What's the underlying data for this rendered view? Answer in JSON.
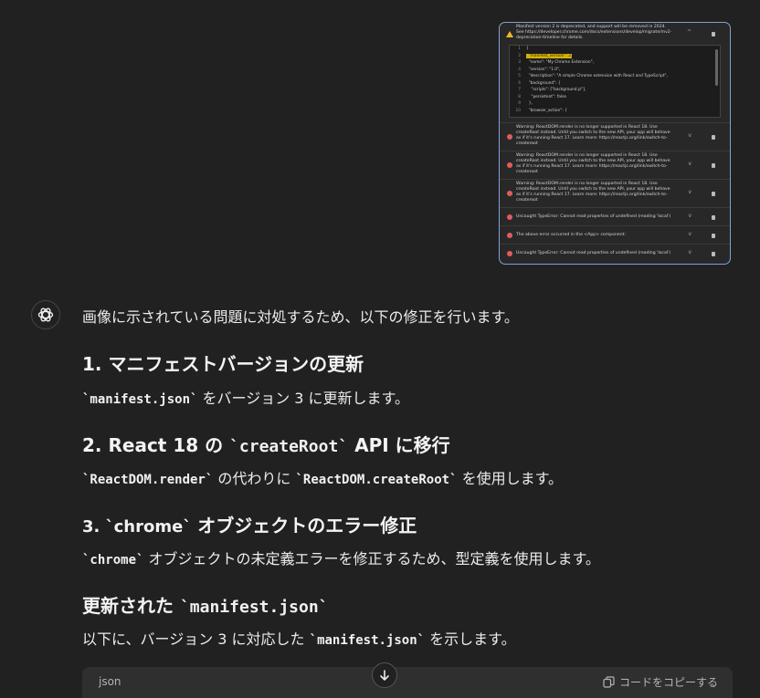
{
  "attachment": {
    "warning": {
      "text": "Manifest version 2 is deprecated, and support will be removed in 2024.\nSee https://developer.chrome.com/docs/extensions/develop/migrate/mv2-\ndeprecation-timeline for details.",
      "code_lines": [
        {
          "n": "1",
          "text": "{"
        },
        {
          "n": "2",
          "text": "  \"manifest_version\": 2,"
        },
        {
          "n": "3",
          "text": "  \"name\": \"My Chrome Extension\","
        },
        {
          "n": "4",
          "text": "  \"version\": \"1.0\","
        },
        {
          "n": "5",
          "text": "  \"description\": \"A simple Chrome extension with React and TypeScript\","
        },
        {
          "n": "6",
          "text": "  \"background\": {"
        },
        {
          "n": "7",
          "text": "    \"scripts\": [\"background.js\"],"
        },
        {
          "n": "8",
          "text": "    \"persistent\": false"
        },
        {
          "n": "9",
          "text": "  },"
        },
        {
          "n": "10",
          "text": "  \"browser_action\": {"
        }
      ]
    },
    "errors": [
      "Warning: ReactDOM.render is no longer supported in React 18. Use\ncreateRoot instead. Until you switch to the new API, your app will behave\nas if it's running React 17. Learn more: https://reactjs.org/link/switch-to-\ncreateroot",
      "Warning: ReactDOM.render is no longer supported in React 18. Use\ncreateRoot instead. Until you switch to the new API, your app will behave\nas if it's running React 17. Learn more: https://reactjs.org/link/switch-to-\ncreateroot",
      "Warning: ReactDOM.render is no longer supported in React 18. Use\ncreateRoot instead. Until you switch to the new API, your app will behave\nas if it's running React 17. Learn more: https://reactjs.org/link/switch-to-\ncreateroot",
      "Uncaught TypeError: Cannot read properties of undefined (reading 'local')",
      "The above error occurred in the <App> component:",
      "Uncaught TypeError: Cannot read properties of undefined (reading 'local')"
    ]
  },
  "message": {
    "intro": "画像に示されている問題に対処するため、以下の修正を行います。",
    "s1": {
      "title": "1. マニフェストバージョンの更新",
      "code": "`manifest.json`",
      "text": " をバージョン 3 に更新します。"
    },
    "s2": {
      "title_a": "2. React 18 の ",
      "title_code": "`createRoot`",
      "title_b": " API に移行",
      "code1": "`ReactDOM.render`",
      "mid": " の代わりに ",
      "code2": "`ReactDOM.createRoot`",
      "end": " を使用します。"
    },
    "s3": {
      "title_code": "3. `chrome`",
      "title_b": " オブジェクトのエラー修正",
      "code": "`chrome`",
      "text": " オブジェクトの未定義エラーを修正するため、型定義を使用します。"
    },
    "s4": {
      "title_a": "更新された ",
      "title_code": "`manifest.json`",
      "pre": "以下に、バージョン 3 に対応した ",
      "code": "`manifest.json`",
      "post": " を示します。"
    }
  },
  "codeblock": {
    "lang": "json",
    "copy_label": "コードをコピーする"
  },
  "colors": {
    "bg": "#212121",
    "text": "#ececec",
    "warn": "#f0b429",
    "error": "#e25c5c",
    "highlight": "#d8b400"
  },
  "icons": [
    "openai-logo-icon",
    "warning-icon",
    "error-icon",
    "chevron-icon",
    "trash-icon",
    "copy-icon",
    "arrow-down-icon"
  ]
}
